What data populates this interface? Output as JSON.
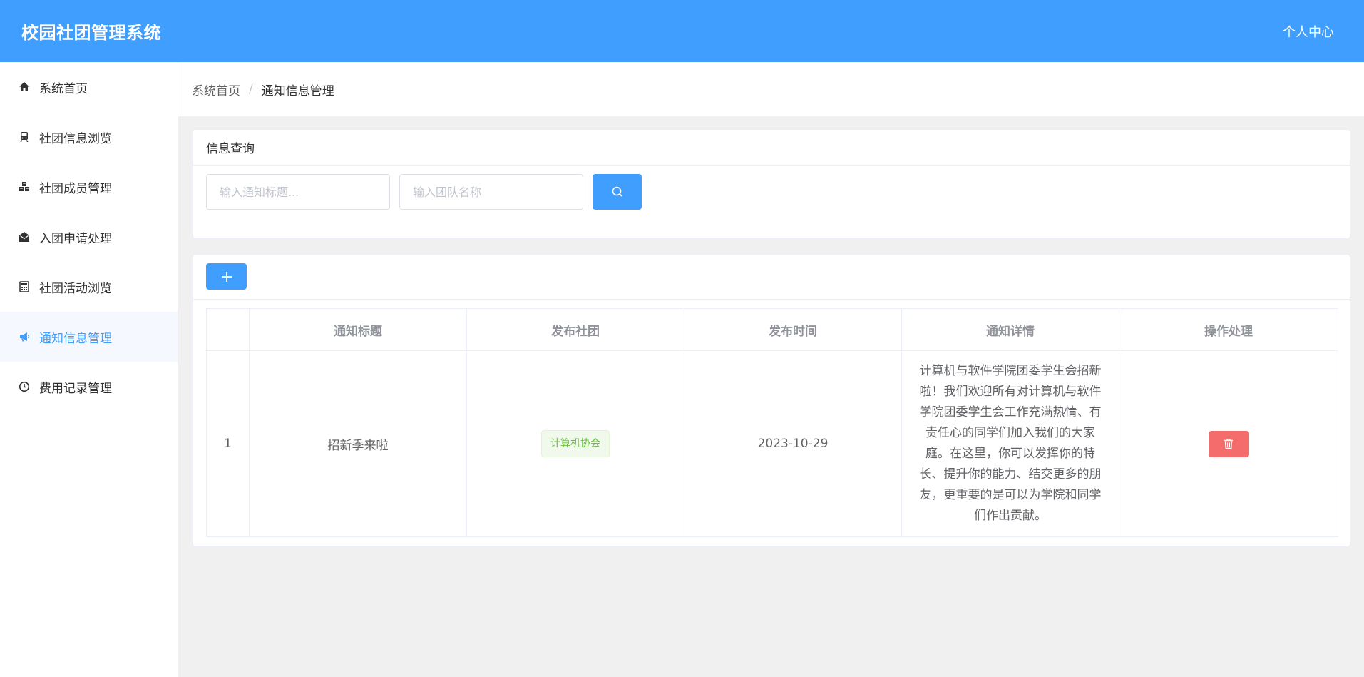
{
  "app": {
    "title": "校园社团管理系统",
    "user_center": "个人中心"
  },
  "sidebar": {
    "items": [
      {
        "label": "系统首页",
        "icon": "home-icon"
      },
      {
        "label": "社团信息浏览",
        "icon": "train-icon"
      },
      {
        "label": "社团成员管理",
        "icon": "cubes-icon"
      },
      {
        "label": "入团申请处理",
        "icon": "envelope-open-icon"
      },
      {
        "label": "社团活动浏览",
        "icon": "calculator-icon"
      },
      {
        "label": "通知信息管理",
        "icon": "bullhorn-icon",
        "active": true
      },
      {
        "label": "费用记录管理",
        "icon": "clock-icon"
      }
    ]
  },
  "breadcrumb": {
    "home": "系统首页",
    "separator": "/",
    "current": "通知信息管理"
  },
  "search": {
    "title": "信息查询",
    "title_placeholder": "输入通知标题...",
    "team_placeholder": "输入团队名称"
  },
  "table": {
    "columns": [
      "",
      "通知标题",
      "发布社团",
      "发布时间",
      "通知详情",
      "操作处理"
    ],
    "rows": [
      {
        "index": "1",
        "title": "招新季来啦",
        "club": "计算机协会",
        "time": "2023-10-29",
        "detail": "计算机与软件学院团委学生会招新啦！我们欢迎所有对计算机与软件学院团委学生会工作充满热情、有责任心的同学们加入我们的大家庭。在这里，你可以发挥你的特长、提升你的能力、结交更多的朋友，更重要的是可以为学院和同学们作出贡献。"
      }
    ]
  },
  "colors": {
    "primary": "#409eff",
    "danger": "#f56c6c",
    "success_text": "#67c23a",
    "success_bg": "#f0f9eb"
  }
}
